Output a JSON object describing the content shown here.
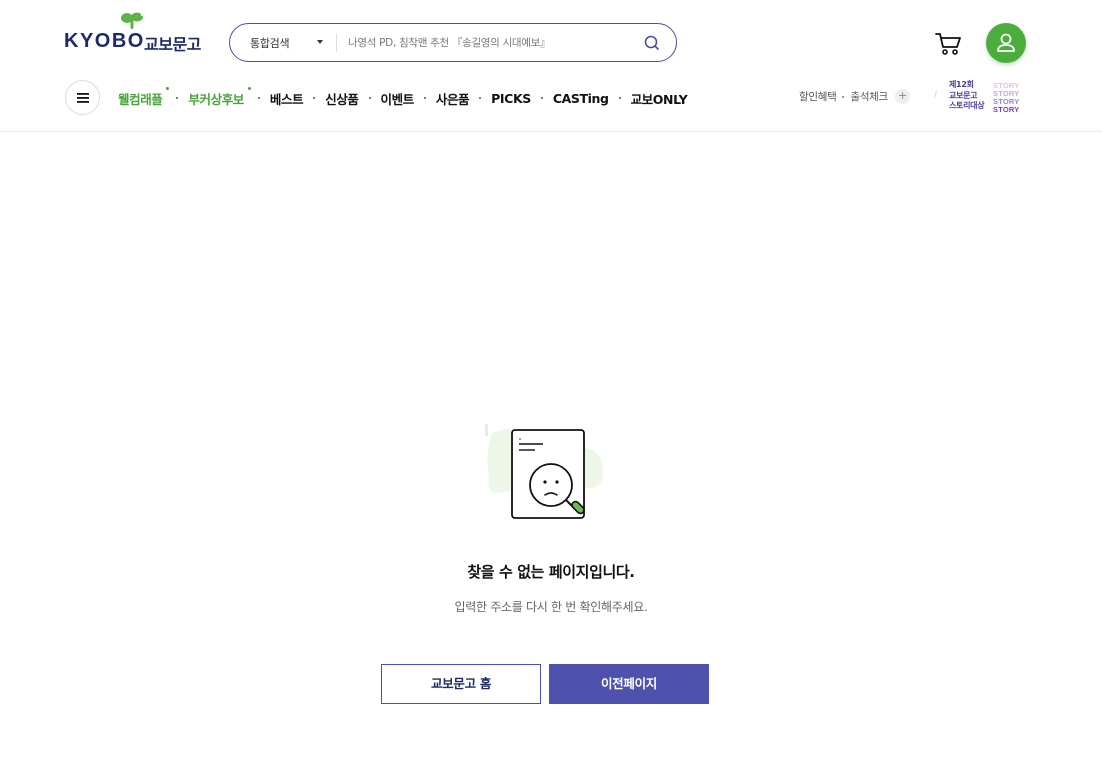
{
  "colors": {
    "brand_navy": "#1d2a6b",
    "brand_green": "#4aa43a",
    "primary_button": "#4f52ad",
    "search_border": "#4b4f9e"
  },
  "header": {
    "logo": {
      "english": "KYOBO",
      "korean": "교보문고"
    },
    "search": {
      "category_label": "통합검색",
      "placeholder": "나영석 PD, 침착맨 추천 『송길영의 시대예보』",
      "icon": "search-icon"
    },
    "cart_icon": "cart-icon",
    "profile_icon": "user-icon"
  },
  "nav": {
    "menu_icon": "hamburger-icon",
    "items": [
      {
        "label": "웰컴래플",
        "highlight": true
      },
      {
        "label": "부커상후보",
        "highlight": true
      },
      {
        "label": "베스트",
        "highlight": false
      },
      {
        "label": "신상품",
        "highlight": false
      },
      {
        "label": "이벤트",
        "highlight": false
      },
      {
        "label": "사은품",
        "highlight": false
      },
      {
        "label": "PICKS",
        "highlight": false
      },
      {
        "label": "CASTing",
        "highlight": false
      },
      {
        "label": "교보ONLY",
        "highlight": false
      }
    ],
    "util": {
      "discount": "할인혜택",
      "attendance": "출석체크",
      "plus": "+"
    },
    "story_banner": {
      "line1": "제12회",
      "line2": "교보문고",
      "line3": "스토리대상",
      "word": "STORY"
    }
  },
  "error": {
    "title": "찾을 수 없는 페이지입니다.",
    "description": "입력한 주소를 다시 한 번 확인해주세요.",
    "illustration_icon": "document-sad-magnifier-icon"
  },
  "buttons": {
    "home": "교보문고 홈",
    "previous": "이전페이지"
  }
}
